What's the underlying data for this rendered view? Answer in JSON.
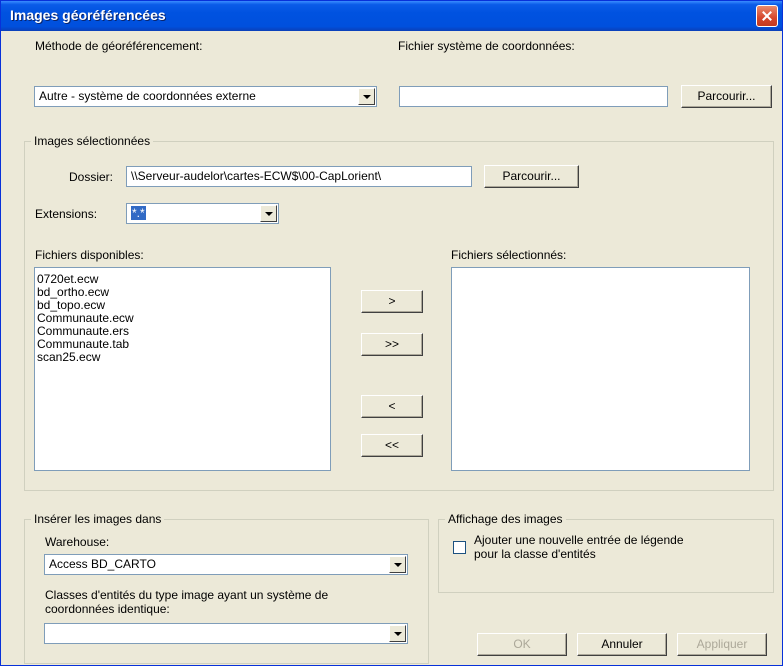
{
  "window": {
    "title": "Images géoréférencées"
  },
  "method": {
    "label": "Méthode de géoréférencement:",
    "value": "Autre - système de coordonnées externe"
  },
  "coord_file": {
    "label": "Fichier système de coordonnées:",
    "value": "",
    "browse_label": "Parcourir..."
  },
  "selected_images": {
    "group_label": "Images sélectionnées",
    "folder_label": "Dossier:",
    "folder_value": "\\\\Serveur-audelor\\cartes-ECW$\\00-CapLorient\\",
    "browse_label": "Parcourir...",
    "extensions_label": "Extensions:",
    "extensions_value": "*.*",
    "available_label": "Fichiers disponibles:",
    "available_files": [
      "0720et.ecw",
      "bd_ortho.ecw",
      "bd_topo.ecw",
      "Communaute.ecw",
      "Communaute.ers",
      "Communaute.tab",
      "scan25.ecw"
    ],
    "selected_label": "Fichiers sélectionnés:",
    "add_label": ">",
    "add_all_label": ">>",
    "remove_label": "<",
    "remove_all_label": "<<"
  },
  "insert": {
    "group_label": "Insérer les images dans",
    "warehouse_label": "Warehouse:",
    "warehouse_value": "Access BD_CARTO",
    "classes_label_line1": "Classes d'entités du type image ayant un système de",
    "classes_label_line2": "coordonnées identique:",
    "classes_value": ""
  },
  "display": {
    "group_label": "Affichage des images",
    "checkbox_line1": "Ajouter une nouvelle entrée de légende",
    "checkbox_line2": "pour la classe d'entités",
    "checked": false
  },
  "footer": {
    "ok_label": "OK",
    "cancel_label": "Annuler",
    "apply_label": "Appliquer"
  }
}
